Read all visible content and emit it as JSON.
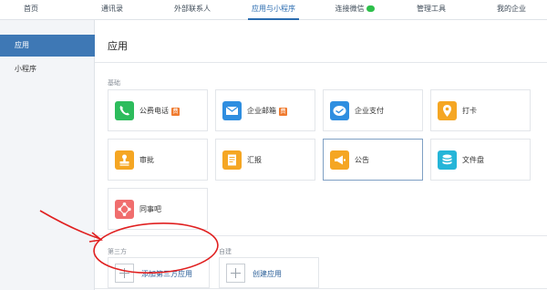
{
  "topnav": {
    "tabs": [
      {
        "label": "首页"
      },
      {
        "label": "通讯录"
      },
      {
        "label": "外部联系人"
      },
      {
        "label": "应用与小程序"
      },
      {
        "label": "连接微信"
      },
      {
        "label": "管理工具"
      },
      {
        "label": "我的企业"
      }
    ],
    "active_tab": "应用与小程序"
  },
  "sidebar": {
    "items": [
      {
        "label": "应用"
      },
      {
        "label": "小程序"
      }
    ],
    "active": "应用"
  },
  "main": {
    "title": "应用",
    "sections": {
      "basic": {
        "label": "基础",
        "apps": [
          {
            "label": "公费电话",
            "icon": "phone-icon",
            "color": "#2dbc5c",
            "badge": "费"
          },
          {
            "label": "企业邮箱",
            "icon": "mail-icon",
            "color": "#2f8ee0",
            "badge": "费"
          },
          {
            "label": "企业支付",
            "icon": "payment-icon",
            "color": "#2f8ee0"
          },
          {
            "label": "打卡",
            "icon": "location-pin-icon",
            "color": "#f5a623"
          },
          {
            "label": "审批",
            "icon": "stamp-icon",
            "color": "#f5a623"
          },
          {
            "label": "汇报",
            "icon": "report-icon",
            "color": "#f5a623"
          },
          {
            "label": "公告",
            "icon": "megaphone-icon",
            "color": "#f5a623"
          },
          {
            "label": "文件盘",
            "icon": "database-icon",
            "color": "#25b5d8"
          },
          {
            "label": "同事吧",
            "icon": "network-icon",
            "color": "#f06e6e"
          }
        ]
      },
      "third_party": {
        "label": "第三方",
        "add_label": "添加第三方应用"
      },
      "self_built": {
        "label": "自建",
        "add_label": "创建应用"
      }
    }
  },
  "annotation": {
    "color": "#e02020"
  }
}
